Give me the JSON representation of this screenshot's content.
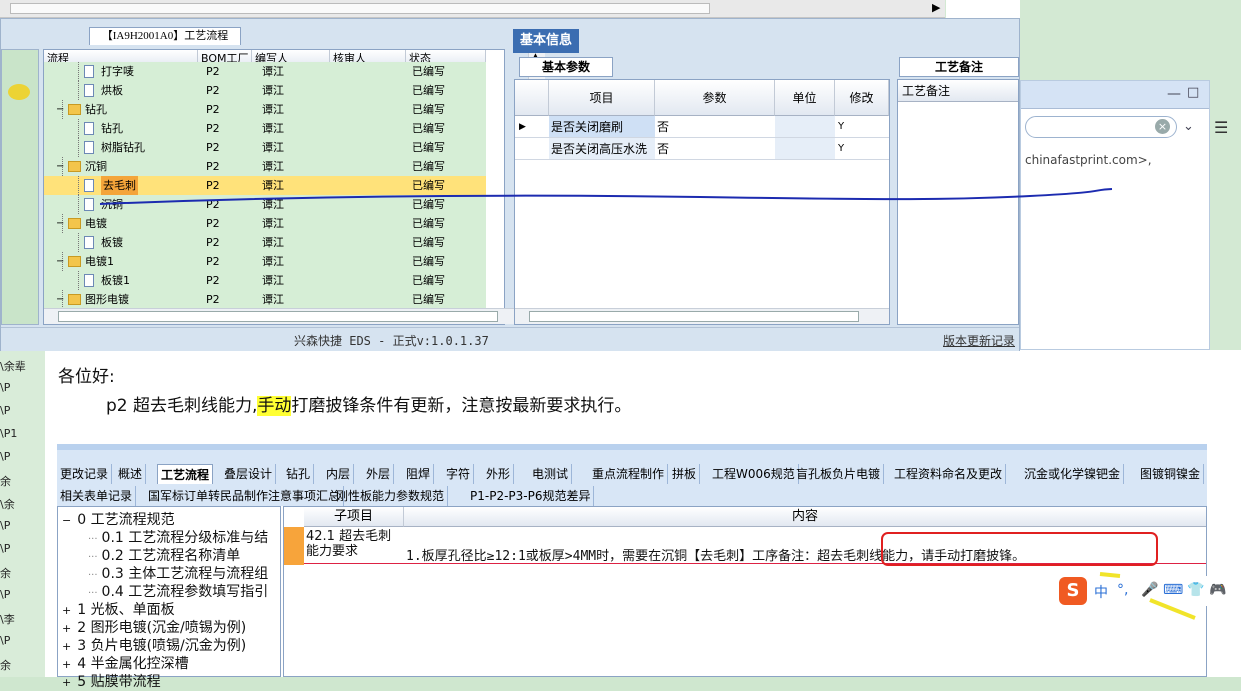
{
  "eds_window": {
    "tree_tab": "【IA9H2001A0】工艺流程",
    "tree_columns": [
      "流程",
      "BOM工厂",
      "编写人",
      "核审人",
      "状态"
    ],
    "tree_rows": [
      {
        "name": "打字唛",
        "bom": "P2",
        "writer": "谭江",
        "status": "已编写",
        "type": "doc",
        "level": 2
      },
      {
        "name": "烘板",
        "bom": "P2",
        "writer": "谭江",
        "status": "已编写",
        "type": "doc",
        "level": 2
      },
      {
        "name": "钻孔",
        "bom": "P2",
        "writer": "谭江",
        "status": "已编写",
        "type": "folder",
        "level": 1
      },
      {
        "name": "钻孔",
        "bom": "P2",
        "writer": "谭江",
        "status": "已编写",
        "type": "doc",
        "level": 2
      },
      {
        "name": "树脂钻孔",
        "bom": "P2",
        "writer": "谭江",
        "status": "已编写",
        "type": "doc",
        "level": 2
      },
      {
        "name": "沉铜",
        "bom": "P2",
        "writer": "谭江",
        "status": "已编写",
        "type": "folder",
        "level": 1
      },
      {
        "name": "去毛刺",
        "bom": "P2",
        "writer": "谭江",
        "status": "已编写",
        "type": "doc",
        "level": 2,
        "selected": true
      },
      {
        "name": "沉铜",
        "bom": "P2",
        "writer": "谭江",
        "status": "已编写",
        "type": "doc",
        "level": 2
      },
      {
        "name": "电镀",
        "bom": "P2",
        "writer": "谭江",
        "status": "已编写",
        "type": "folder",
        "level": 1
      },
      {
        "name": "板镀",
        "bom": "P2",
        "writer": "谭江",
        "status": "已编写",
        "type": "doc",
        "level": 2
      },
      {
        "name": "电镀1",
        "bom": "P2",
        "writer": "谭江",
        "status": "已编写",
        "type": "folder",
        "level": 1
      },
      {
        "name": "板镀1",
        "bom": "P2",
        "writer": "谭江",
        "status": "已编写",
        "type": "doc",
        "level": 2
      },
      {
        "name": "图形电镀",
        "bom": "P2",
        "writer": "谭江",
        "status": "已编写",
        "type": "folder",
        "level": 1
      }
    ],
    "info_title": "基本信息",
    "params_tab": "基本参数",
    "params_columns": [
      "项目",
      "参数",
      "单位",
      "修改"
    ],
    "params_rows": [
      {
        "item": "是否关闭磨刷",
        "value": "否",
        "unit": "",
        "mod": "Y"
      },
      {
        "item": "是否关闭高压水洗",
        "value": "否",
        "unit": "",
        "mod": "Y"
      }
    ],
    "remark_tab": "工艺备注",
    "remark_header": "工艺备注",
    "version": "兴森快捷 EDS - 正式v:1.0.1.37",
    "update_log": "版本更新记录"
  },
  "background": {
    "email_fragment": "chinafastprint.com>,",
    "left_items": [
      "\\余辈",
      "\\P",
      "\\P",
      "\\P1",
      "\\P",
      "余",
      "\\余",
      "\\P",
      "\\P",
      "余",
      "\\P",
      "\\李",
      "\\P",
      "余"
    ]
  },
  "message": {
    "greeting": "各位好:",
    "notice_pre": "p2 超去毛刺线能力,",
    "notice_hl": "手动",
    "notice_post": "打磨披锋条件有更新，注意按最新要求执行。"
  },
  "doc": {
    "tabs_row1": [
      "更改记录",
      "概述",
      "工艺流程",
      "叠层设计",
      "钻孔",
      "内层",
      "外层",
      "阻焊",
      "字符",
      "外形",
      "电测试",
      "重点流程制作",
      "拼板",
      "工程W006规范",
      "盲孔板负片电镀",
      "工程资料命名及更改",
      "沉金或化学镍钯金",
      "图镀铜镍金"
    ],
    "tabs_row2": [
      "相关表单记录",
      "国军标订单转民品制作注意事项汇总",
      "刚性板能力参数规范",
      "P1-P2-P3-P6规范差异"
    ],
    "active_tab": "工艺流程",
    "tree": [
      {
        "label": "0 工艺流程规范",
        "indent": 0,
        "box": "−"
      },
      {
        "label": "0.1 工艺流程分级标准与结",
        "indent": 1
      },
      {
        "label": "0.2 工艺流程名称清单",
        "indent": 1
      },
      {
        "label": "0.3 主体工艺流程与流程组",
        "indent": 1
      },
      {
        "label": "0.4 工艺流程参数填写指引",
        "indent": 1
      },
      {
        "label": "1 光板、单面板",
        "indent": 0,
        "box": "+"
      },
      {
        "label": "2 图形电镀(沉金/喷锡为例)",
        "indent": 0,
        "box": "+"
      },
      {
        "label": "3 负片电镀(喷锡/沉金为例)",
        "indent": 0,
        "box": "+"
      },
      {
        "label": "4 半金属化控深槽",
        "indent": 0,
        "box": "+"
      },
      {
        "label": "5 贴膜带流程",
        "indent": 0,
        "box": "+"
      }
    ],
    "col_sub": "子项目",
    "col_content": "内容",
    "row_sub": "42.1 超去毛刺能力要求",
    "row_content": "1.板厚孔径比≥12:1或板厚>4MM时，需要在沉铜【去毛刺】工序备注：超去毛刺线能力，请手动打磨披锋。"
  },
  "ime": {
    "logo": "S",
    "lang": "中"
  }
}
